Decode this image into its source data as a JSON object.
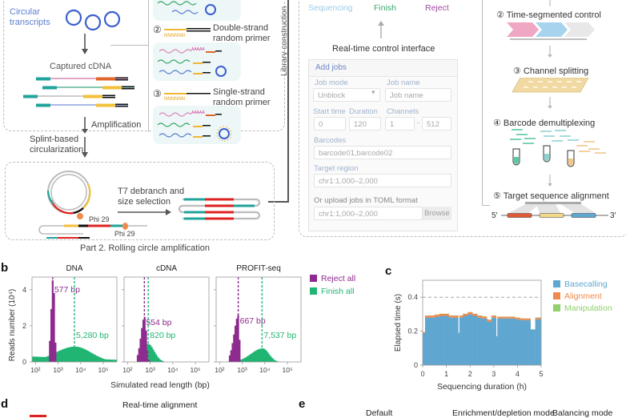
{
  "figure": {
    "panel_a": {
      "part1": {
        "circular_transcripts_label": "Circular\ntranscripts",
        "captured_cdna_label": "Captured cDNA",
        "amplification_label": "Amplification",
        "splint_label": "Splint-based\ncircularization",
        "primer2_num": "②",
        "primer2_label": "Double-strand\nrandom primer",
        "primer3_num": "③",
        "primer3_label": "Single-strand\nrandom primer",
        "n_seq": "NNNNNN",
        "polya": "AAAAA",
        "library_construction": "Library construction"
      },
      "part2": {
        "title": "Part 2. Rolling circle amplification",
        "t7_label": "T7 debranch and\nsize selection",
        "phi29_a": "Phi 29",
        "phi29_b": "Phi 29"
      },
      "control": {
        "states": {
          "sequencing": "Sequencing",
          "finish": "Finish",
          "reject": "Reject"
        },
        "interface_title": "Real-time control interface",
        "form": {
          "header": "Add jobs",
          "job_mode_label": "Job mode",
          "job_mode_value": "Unblock",
          "job_name_label": "Job name",
          "job_name_placeholder": "Job name",
          "start_time_label": "Start time",
          "start_time_value": "0",
          "duration_label": "Duration",
          "duration_value": "120",
          "channels_label": "Channels",
          "channel_from": "1",
          "channel_sep": "-",
          "channel_to": "512",
          "barcodes_label": "Barcodes",
          "barcodes_value": "barcode01,barcode02",
          "target_region_label": "Target region",
          "target_region_value": "chr1:1,000–2,000",
          "toml_label": "Or upload jobs in TOML format",
          "toml_value": "chr1:1,000–2,000",
          "browse": "Browse"
        }
      },
      "steps": {
        "s2": "② Time-segmented control",
        "s3": "③ Channel splitting",
        "s4": "④ Barcode demultiplexing",
        "s5": "⑤ Target sequence alignment",
        "five_prime": "5′",
        "three_prime": "3′"
      }
    },
    "panel_d": {
      "letter": "d",
      "title": "Real-time alignment"
    },
    "panel_e": {
      "letter": "e",
      "cols": [
        "Default",
        "Enrichment/depletion mode",
        "Balancing mode"
      ]
    },
    "colors": {
      "reject": "#8e2b8e",
      "finish": "#21b573",
      "basecalling": "#5fa7d1",
      "alignment": "#f08a4b",
      "manipulation": "#8fd16a"
    }
  },
  "chart_data": [
    {
      "type": "bar",
      "panel": "b",
      "title": "DNA",
      "xlabel": "Simulated read length (bp)",
      "ylabel": "Reads number (10⁴)",
      "xscale": "log",
      "xlim": [
        70,
        400000
      ],
      "ylim": [
        0,
        4.7
      ],
      "xticks": [
        "10²",
        "10³",
        "10⁴",
        "10⁵"
      ],
      "yticks": [
        "0",
        "2",
        "4"
      ],
      "series": [
        {
          "name": "Reject all",
          "median_bp": 577,
          "annotation": "577 bp",
          "peak": 4.7,
          "peak_bp": 600,
          "range_bp": [
            380,
            850
          ]
        },
        {
          "name": "Finish all",
          "median_bp": 5280,
          "annotation": "5,280 bp",
          "peak": 0.85,
          "peak_bp": 5500,
          "range_bp": [
            70,
            400000
          ]
        }
      ]
    },
    {
      "type": "bar",
      "panel": "b",
      "title": "cDNA",
      "xscale": "log",
      "xlim": [
        70,
        400000
      ],
      "ylim": [
        0,
        4.7
      ],
      "xticks": [
        "10²",
        "10³",
        "10⁴",
        "10⁵"
      ],
      "series": [
        {
          "name": "Reject all",
          "median_bp": 554,
          "annotation": "554 bp",
          "peak": 2.5,
          "peak_bp": 560,
          "range_bp": [
            250,
            900
          ]
        },
        {
          "name": "Finish all",
          "median_bp": 820,
          "annotation": "820 bp",
          "peak": 1.0,
          "peak_bp": 800,
          "range_bp": [
            300,
            4000
          ]
        }
      ]
    },
    {
      "type": "bar",
      "panel": "b",
      "title": "PROFIT-seq",
      "xscale": "log",
      "xlim": [
        70,
        400000
      ],
      "ylim": [
        0,
        4.7
      ],
      "xticks": [
        "10²",
        "10³",
        "10⁴",
        "10⁵"
      ],
      "legend": [
        "Reject all",
        "Finish all"
      ],
      "legend_position": "right",
      "series": [
        {
          "name": "Reject all",
          "median_bp": 667,
          "annotation": "667 bp",
          "peak": 2.6,
          "peak_bp": 680,
          "range_bp": [
            250,
            850
          ]
        },
        {
          "name": "Finish all",
          "median_bp": 7537,
          "annotation": "7,537 bp",
          "peak": 0.75,
          "peak_bp": 8000,
          "range_bp": [
            600,
            40000
          ]
        }
      ]
    },
    {
      "type": "area",
      "panel": "c",
      "xlabel": "Sequencing duration (h)",
      "ylabel": "Elapsed time (s)",
      "xlim": [
        0,
        5
      ],
      "ylim": [
        0,
        0.5
      ],
      "xticks": [
        "0",
        "1",
        "2",
        "3",
        "4",
        "5"
      ],
      "yticks": [
        "0",
        "0.2",
        "0.4"
      ],
      "reference_line": 0.4,
      "legend": [
        "Basecalling",
        "Alignment",
        "Manipulation"
      ],
      "legend_position": "right",
      "x": [
        0,
        0.05,
        0.1,
        0.3,
        0.5,
        0.7,
        0.9,
        1.1,
        1.3,
        1.45,
        1.5,
        1.55,
        1.7,
        1.9,
        2.1,
        2.3,
        2.5,
        2.7,
        2.75,
        2.9,
        3.05,
        3.1,
        3.15,
        3.3,
        3.5,
        3.7,
        3.9,
        4.1,
        4.3,
        4.5,
        4.55,
        4.7,
        4.75,
        4.9,
        5.0
      ],
      "series": [
        {
          "name": "Basecalling",
          "values": [
            0.19,
            0.19,
            0.28,
            0.28,
            0.285,
            0.29,
            0.29,
            0.28,
            0.28,
            0.28,
            0.19,
            0.28,
            0.29,
            0.3,
            0.29,
            0.28,
            0.275,
            0.26,
            0.255,
            0.28,
            0.28,
            0.17,
            0.275,
            0.275,
            0.275,
            0.275,
            0.27,
            0.265,
            0.265,
            0.265,
            0.21,
            0.21,
            0.27,
            0.27,
            0.265
          ]
        },
        {
          "name": "Alignment",
          "values": [
            0.005,
            0.005,
            0.012,
            0.012,
            0.012,
            0.012,
            0.012,
            0.012,
            0.012,
            0.012,
            0.0,
            0.012,
            0.012,
            0.012,
            0.012,
            0.012,
            0.012,
            0.012,
            0.012,
            0.012,
            0.012,
            0.0,
            0.01,
            0.01,
            0.01,
            0.01,
            0.01,
            0.01,
            0.01,
            0.01,
            0.0,
            0.0,
            0.01,
            0.01,
            0.01
          ]
        },
        {
          "name": "Manipulation",
          "values": [
            0.001,
            0.001,
            0.001,
            0.001,
            0.001,
            0.001,
            0.001,
            0.001,
            0.001,
            0.001,
            0.001,
            0.001,
            0.001,
            0.001,
            0.001,
            0.001,
            0.001,
            0.001,
            0.001,
            0.001,
            0.001,
            0.001,
            0.001,
            0.001,
            0.001,
            0.001,
            0.001,
            0.001,
            0.001,
            0.001,
            0.001,
            0.001,
            0.001,
            0.001,
            0.001
          ]
        }
      ]
    }
  ]
}
